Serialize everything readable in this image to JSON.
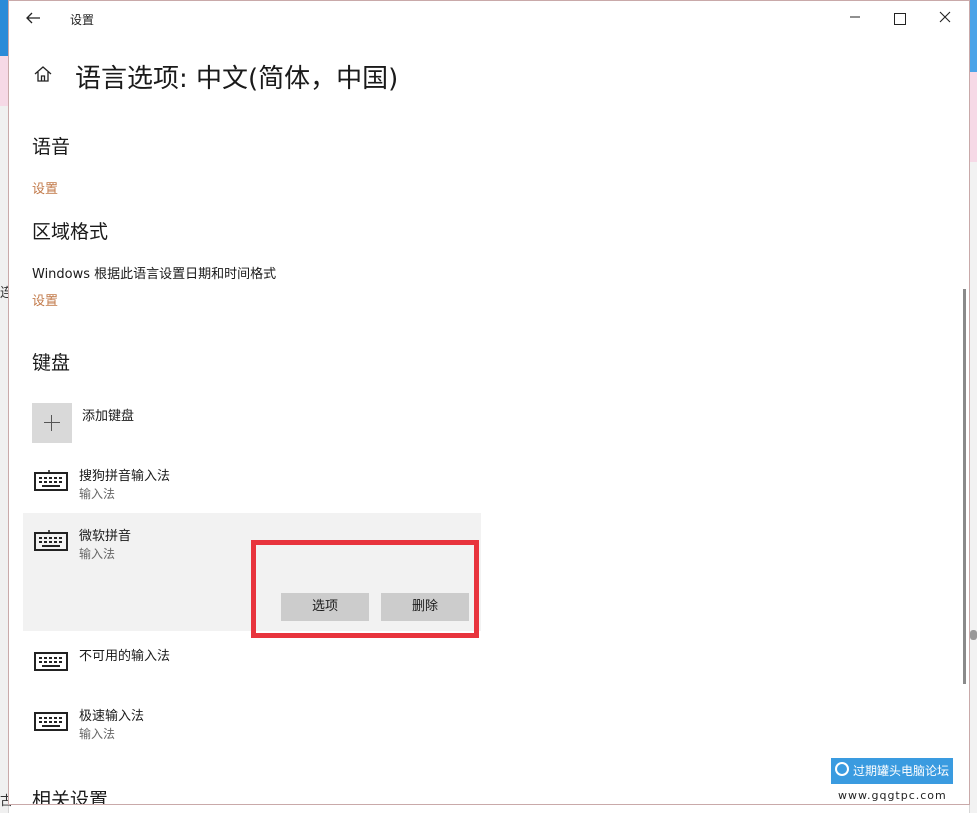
{
  "window": {
    "title": "设置",
    "page_title": "语言选项: 中文(简体，中国)"
  },
  "sections": {
    "speech": {
      "heading": "语音",
      "link": "设置"
    },
    "region": {
      "heading": "区域格式",
      "description": "Windows 根据此语言设置日期和时间格式",
      "link": "设置"
    },
    "keyboard": {
      "heading": "键盘",
      "add_label": "添加键盘",
      "items": [
        {
          "name": "搜狗拼音输入法",
          "type": "输入法"
        },
        {
          "name": "微软拼音",
          "type": "输入法"
        },
        {
          "name": "不可用的输入法",
          "type": ""
        },
        {
          "name": "极速输入法",
          "type": "输入法"
        }
      ],
      "options_button": "选项",
      "remove_button": "删除"
    },
    "related": {
      "heading": "相关设置"
    }
  },
  "background": {
    "left_text_1": "连",
    "left_text_2": "古"
  },
  "watermark": {
    "text": "过期罐头电脑论坛",
    "url": "www.gqgtpc.com"
  },
  "colors": {
    "link": "#c27a4a",
    "highlight_border": "#e8343d",
    "selected_bg": "#f2f2f2",
    "button_bg": "#cccccc"
  }
}
